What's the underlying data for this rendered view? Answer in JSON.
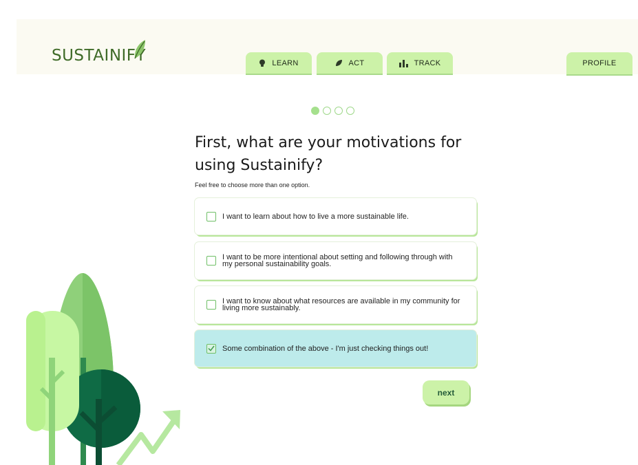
{
  "app": {
    "logo_text": "SUSTAINIFY"
  },
  "nav": {
    "tabs": [
      {
        "label": "LEARN",
        "icon": "lightbulb-icon"
      },
      {
        "label": "ACT",
        "icon": "leaf-icon"
      },
      {
        "label": "TRACK",
        "icon": "bar-chart-icon"
      }
    ],
    "profile_label": "PROFILE"
  },
  "progress": {
    "current_step": 1,
    "total_steps": 4
  },
  "question": {
    "title": "First, what are your motivations for using Sustainify?",
    "hint": "Feel free to choose more than one option."
  },
  "options": [
    {
      "text": "I want to learn about how to live a more sustainable life.",
      "checked": false
    },
    {
      "text": "I want to be more intentional about setting and following through with my personal sustainability goals.",
      "checked": false
    },
    {
      "text": "I want to know about what resources are available in my community for living more sustainably.",
      "checked": false
    },
    {
      "text": "Some combination of the above - I'm just checking things out!",
      "checked": true
    }
  ],
  "actions": {
    "next_label": "next"
  },
  "colors": {
    "tab_bg": "#ccf2a8",
    "selected_option_bg": "#bdebeb",
    "brand_green": "#3f6b28",
    "header_bg": "#fbfaf2"
  }
}
